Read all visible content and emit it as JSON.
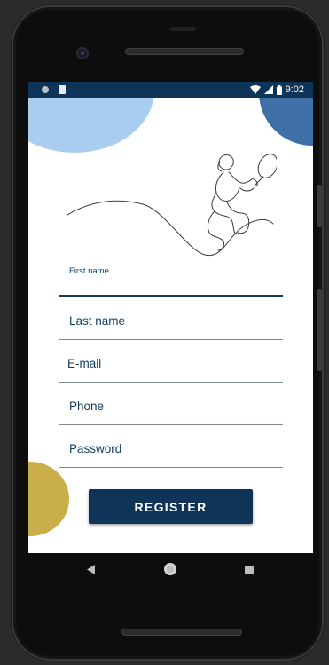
{
  "status_bar": {
    "time": "9:02",
    "icons": [
      "notification-dot-icon",
      "sd-card-icon",
      "wifi-icon",
      "signal-icon",
      "battery-icon"
    ]
  },
  "form": {
    "fields": [
      {
        "label": "First name",
        "value": "",
        "state": "focused"
      },
      {
        "label": "Last name",
        "value": ""
      },
      {
        "label": "E-mail",
        "value": ""
      },
      {
        "label": "Phone",
        "value": ""
      },
      {
        "label": "Password",
        "value": ""
      }
    ],
    "register_label": "REGISTER"
  },
  "nav_bar": {
    "buttons": [
      "back-icon",
      "home-icon",
      "recents-icon"
    ]
  },
  "colors": {
    "primary": "#0e3557",
    "light_blue": "#a8cdef",
    "mid_blue": "#3f6fa7",
    "gold": "#c9ae4a"
  }
}
